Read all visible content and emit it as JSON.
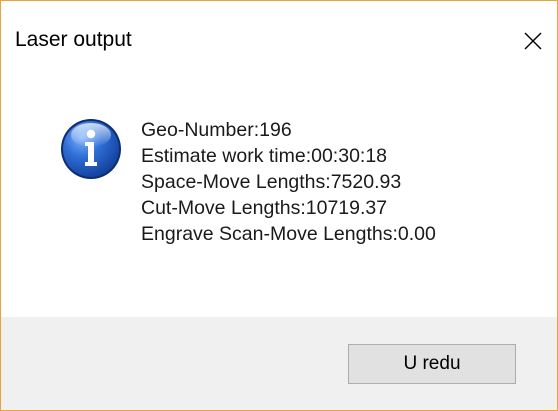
{
  "window": {
    "title": "Laser output",
    "close_icon": "close-icon",
    "border_color": "#e8a33a"
  },
  "content": {
    "icon": "info-icon",
    "lines": [
      "Geo-Number:196",
      "Estimate work time:00:30:18",
      "Space-Move Lengths:7520.93",
      "Cut-Move Lengths:10719.37",
      "Engrave Scan-Move Lengths:0.00"
    ]
  },
  "footer": {
    "ok_label": "U redu"
  }
}
